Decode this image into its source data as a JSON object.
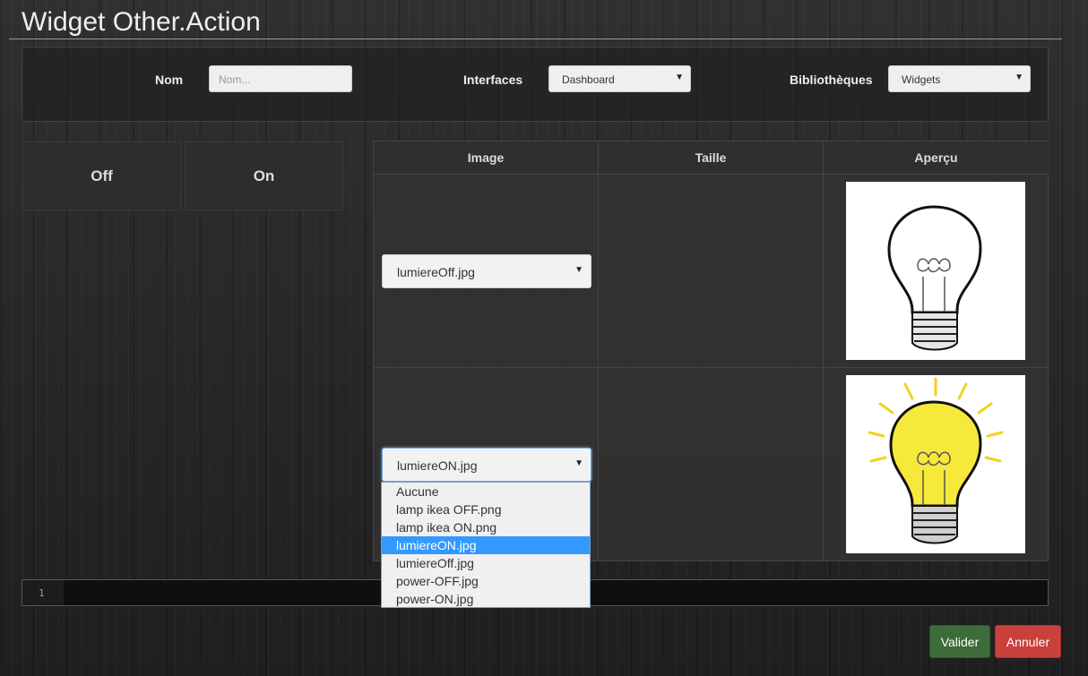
{
  "page": {
    "title": "Widget Other.Action"
  },
  "filters": {
    "name_label": "Nom",
    "name_placeholder": "Nom...",
    "interfaces_label": "Interfaces",
    "interfaces_value": "Dashboard",
    "libraries_label": "Bibliothèques",
    "libraries_value": "Widgets"
  },
  "states": [
    {
      "label": "Off"
    },
    {
      "label": "On"
    }
  ],
  "table": {
    "headers": {
      "image": "Image",
      "size": "Taille",
      "preview": "Aperçu"
    },
    "rows": [
      {
        "image": "lumiereOff.jpg",
        "size": "",
        "preview": "lightbulb-off-icon"
      },
      {
        "image": "lumiereON.jpg",
        "size": "",
        "preview": "lightbulb-on-icon"
      }
    ]
  },
  "dropdown": {
    "options": [
      "Aucune",
      "lamp ikea OFF.png",
      "lamp ikea ON.png",
      "lumiereON.jpg",
      "lumiereOff.jpg",
      "power-OFF.jpg",
      "power-ON.jpg"
    ],
    "selected": "lumiereON.jpg"
  },
  "editor": {
    "line_number": "1"
  },
  "buttons": {
    "validate": "Valider",
    "cancel": "Annuler"
  },
  "colors": {
    "validate": "#3d6b3a",
    "cancel": "#c9403c",
    "selected_option": "#3399ff"
  }
}
